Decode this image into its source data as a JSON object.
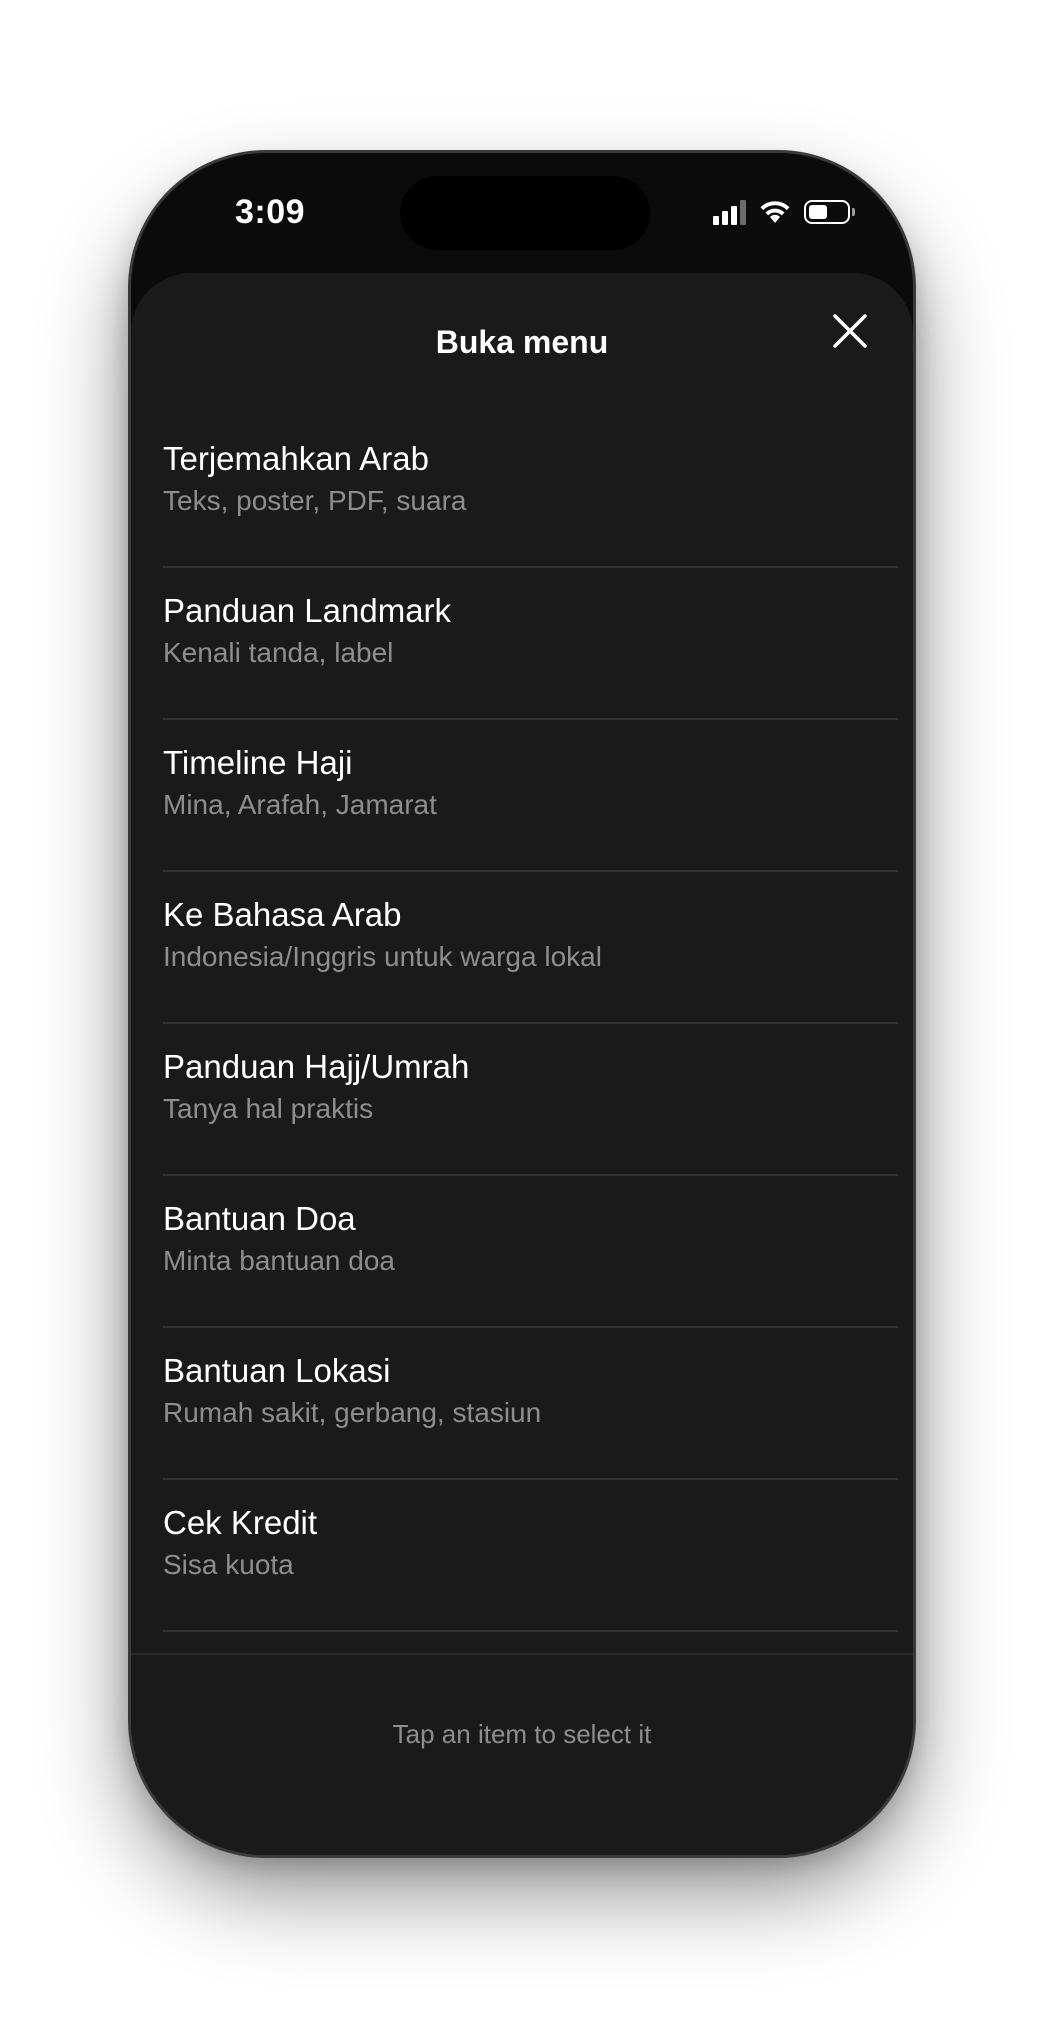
{
  "status_bar": {
    "time": "3:09",
    "icons": [
      "cellular-signal-icon",
      "wifi-icon",
      "battery-icon"
    ],
    "battery_level": 0.5
  },
  "sheet": {
    "title": "Buka menu",
    "close_icon": "close-icon"
  },
  "menu": {
    "items": [
      {
        "label": "Terjemahkan Arab",
        "sub": "Teks, poster, PDF, suara"
      },
      {
        "label": "Panduan Landmark",
        "sub": "Kenali tanda, label"
      },
      {
        "label": "Timeline Haji",
        "sub": "Mina, Arafah, Jamarat"
      },
      {
        "label": "Ke Bahasa Arab",
        "sub": "Indonesia/Inggris untuk warga lokal"
      },
      {
        "label": "Panduan Hajj/Umrah",
        "sub": "Tanya hal praktis"
      },
      {
        "label": "Bantuan Doa",
        "sub": "Minta bantuan doa"
      },
      {
        "label": "Bantuan Lokasi",
        "sub": "Rumah sakit, gerbang, stasiun"
      },
      {
        "label": "Cek Kredit",
        "sub": "Sisa kuota"
      }
    ]
  },
  "footer": {
    "hint": "Tap an item to select it"
  },
  "colors": {
    "sheet_background": "#1a1a1a",
    "primary_text": "#ffffff",
    "secondary_text": "#8e8e8e",
    "divider": "#333333"
  }
}
